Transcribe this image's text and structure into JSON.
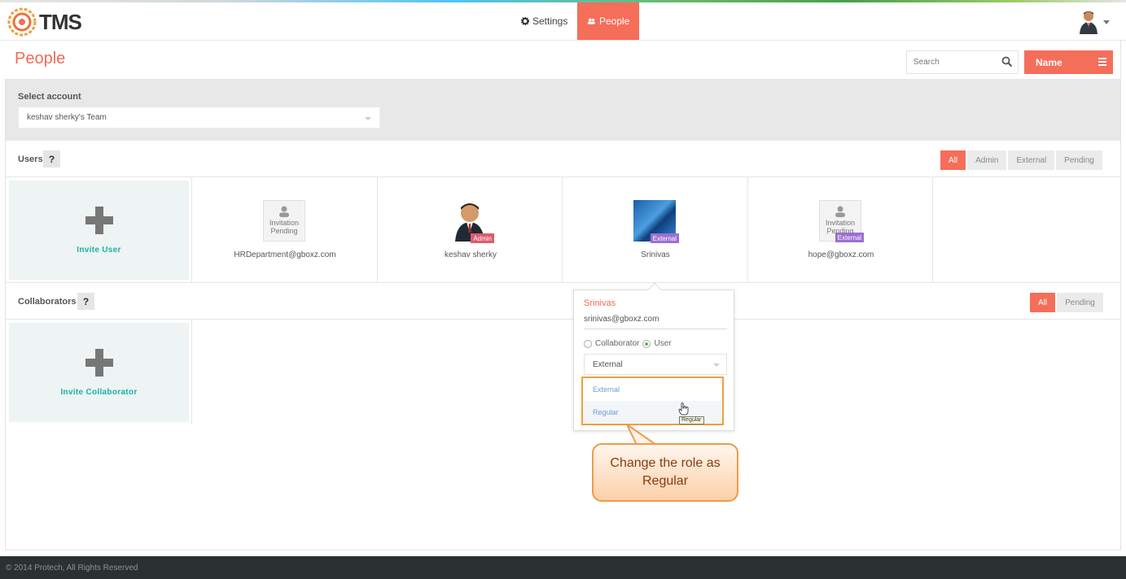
{
  "app": {
    "name": "TMS"
  },
  "nav": {
    "settings_label": "Settings",
    "people_label": "People"
  },
  "page": {
    "title": "People"
  },
  "search": {
    "placeholder": "Search"
  },
  "sort": {
    "label": "Name"
  },
  "account": {
    "label": "Select account",
    "value": "keshav sherky's Team"
  },
  "users": {
    "label": "Users",
    "help": "?",
    "filters": [
      "All",
      "Admin",
      "External",
      "Pending"
    ],
    "invite_label": "Invite User",
    "cards": [
      {
        "name": "HRDepartment@gboxz.com",
        "pending_text": "Invitation Pending",
        "badge": ""
      },
      {
        "name": "keshav sherky",
        "badge": "Admin"
      },
      {
        "name": "Srinivas",
        "badge": "External"
      },
      {
        "name": "hope@gboxz.com",
        "pending_text": "Invitation Pending",
        "badge": "External"
      }
    ]
  },
  "collaborators": {
    "label": "Collaborators",
    "help": "?",
    "filters": [
      "All",
      "Pending"
    ],
    "invite_label": "Invite Collaborator"
  },
  "popover": {
    "name": "Srinivas",
    "email": "srinivas@gboxz.com",
    "radio_collaborator": "Collaborator",
    "radio_user": "User",
    "role_value": "External",
    "options": [
      "External",
      "Regular"
    ],
    "tooltip": "Regular"
  },
  "callout": {
    "text": "Change the role as Regular"
  },
  "footer": {
    "copyright": "© 2014 Protech, All Rights Reserved"
  },
  "colors": {
    "accent": "#f56e5a",
    "teal": "#1ab2a8",
    "admin_badge": "#e05a6d",
    "external_badge": "#9c6fd1",
    "highlight": "#f0a040"
  }
}
